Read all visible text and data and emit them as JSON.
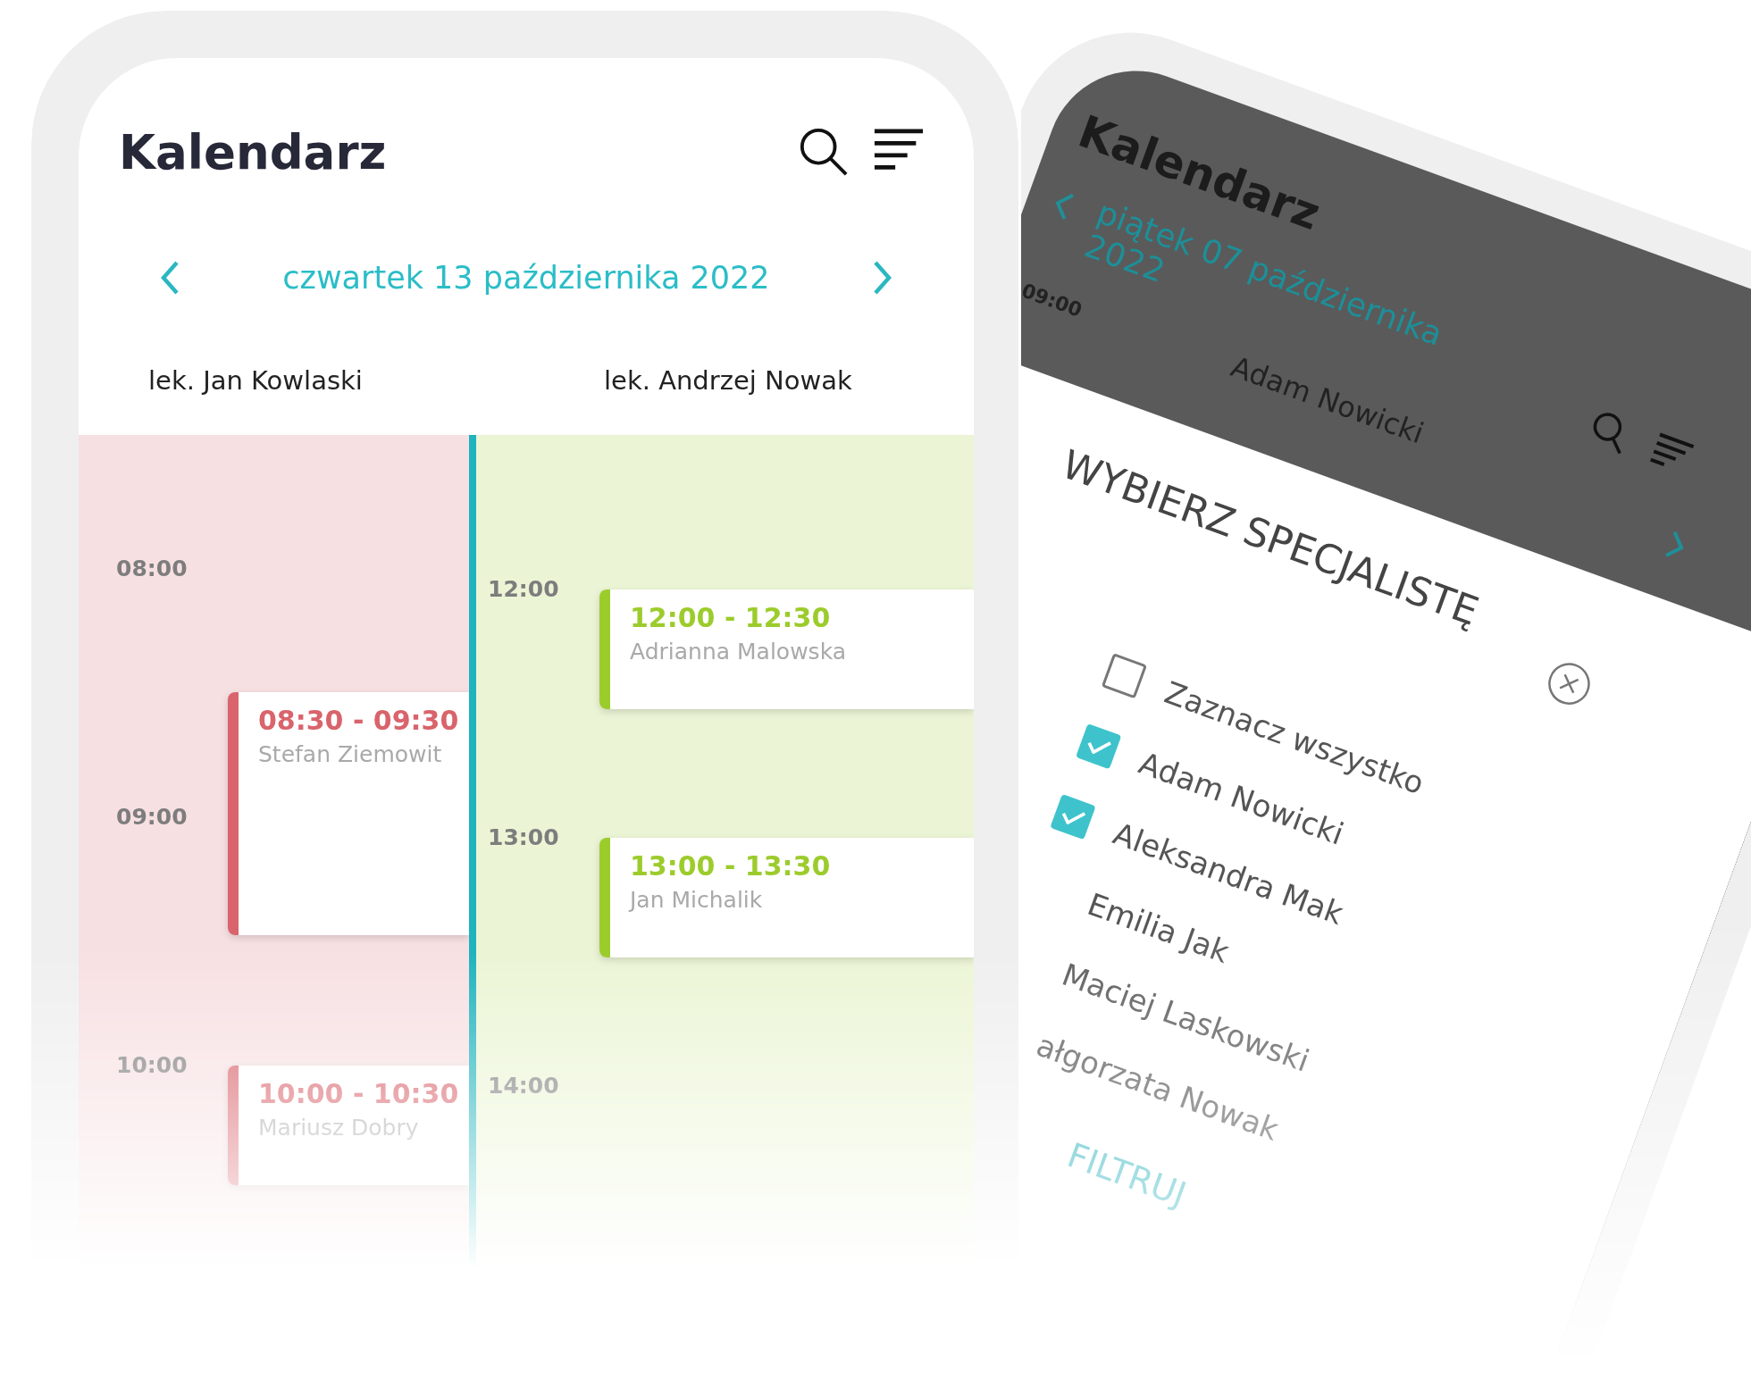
{
  "left_phone": {
    "title": "Kalendarz",
    "date": "czwartek 13 października 2022",
    "columns": [
      {
        "doctor": "lek. Jan Kowlaski",
        "color": "#d9646c",
        "hours": [
          {
            "label": "08:00",
            "appointments": [
              {
                "time": "08:30 - 09:30",
                "patient": "Stefan Ziemowit",
                "kind": "long"
              }
            ]
          },
          {
            "label": "09:00"
          },
          {
            "label": "10:00",
            "appointments": [
              {
                "time": "10:00 - 10:30",
                "patient": "Mariusz Dobry",
                "kind": "short"
              }
            ]
          }
        ]
      },
      {
        "doctor": "lek. Andrzej Nowak",
        "color": "#9ccc2c",
        "hours": [
          {
            "label": "12:00",
            "appointments": [
              {
                "time": "12:00 - 12:30",
                "patient": "Adrianna Malowska",
                "kind": "short"
              }
            ]
          },
          {
            "label": "13:00",
            "appointments": [
              {
                "time": "13:00 - 13:30",
                "patient": "Jan Michalik",
                "kind": "short"
              }
            ]
          },
          {
            "label": "14:00"
          }
        ]
      }
    ]
  },
  "right_phone": {
    "title": "Kalendarz",
    "date": "piątek 07 października 2022",
    "time": "09:00",
    "doctor": "Adam Nowicki",
    "modal": {
      "title": "WYBIERZ SPECJALISTĘ",
      "options": [
        {
          "label": "Zaznacz wszystko",
          "checked": false
        },
        {
          "label": "Adam Nowicki",
          "checked": true
        },
        {
          "label": "Aleksandra Mak",
          "checked": true
        },
        {
          "label": "Emilia Jak"
        },
        {
          "label": "Maciej Laskowski"
        },
        {
          "label": "ałgorzata Nowak"
        }
      ],
      "button": "FILTRUJ"
    }
  }
}
